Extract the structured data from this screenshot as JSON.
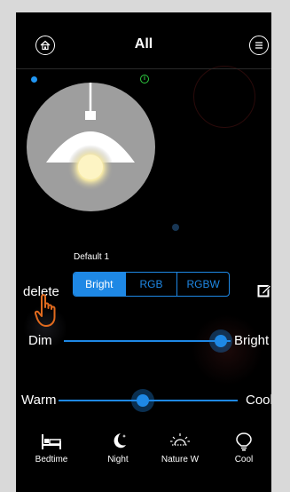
{
  "header": {
    "title": "All",
    "home_icon": "home-icon",
    "menu_icon": "menu-icon"
  },
  "lamp": {
    "name": "Default 1",
    "status_dot_color": "#2196f3",
    "badge_color": "#2ecc40"
  },
  "controls": {
    "delete_label": "delete",
    "modes": [
      "Bright",
      "RGB",
      "RGBW"
    ],
    "active_mode": "Bright",
    "accent_color": "#1e88e5"
  },
  "brightness": {
    "min_label": "Dim",
    "max_label": "Bright",
    "value_fraction": 0.94
  },
  "temperature": {
    "min_label": "Warm",
    "max_label": "Cool",
    "value_fraction": 0.47
  },
  "scenes": [
    {
      "label": "Bedtime",
      "icon": "bed-icon"
    },
    {
      "label": "Night",
      "icon": "moon-icon"
    },
    {
      "label": "Nature W",
      "icon": "sun-icon"
    },
    {
      "label": "Cool",
      "icon": "bulb-icon"
    }
  ]
}
